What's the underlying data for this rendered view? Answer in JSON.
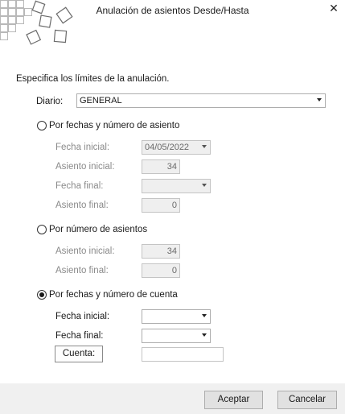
{
  "window": {
    "title": "Anulación de asientos Desde/Hasta",
    "close_icon": "close-icon"
  },
  "intro": "Especifica los límites de la anulación.",
  "diario": {
    "label": "Diario:",
    "value": "GENERAL"
  },
  "option1": {
    "label": "Por fechas y número de asiento",
    "selected": false,
    "fecha_inicial_label": "Fecha inicial:",
    "fecha_inicial_value": "04/05/2022",
    "asiento_inicial_label": "Asiento inicial:",
    "asiento_inicial_value": "34",
    "fecha_final_label": "Fecha final:",
    "fecha_final_value": "",
    "asiento_final_label": "Asiento final:",
    "asiento_final_value": "0"
  },
  "option2": {
    "label": "Por número de asientos",
    "selected": false,
    "asiento_inicial_label": "Asiento inicial:",
    "asiento_inicial_value": "34",
    "asiento_final_label": "Asiento final:",
    "asiento_final_value": "0"
  },
  "option3": {
    "label": "Por fechas y número de cuenta",
    "selected": true,
    "fecha_inicial_label": "Fecha inicial:",
    "fecha_inicial_value": "",
    "fecha_final_label": "Fecha final:",
    "fecha_final_value": "",
    "cuenta_button": "Cuenta:",
    "cuenta_value": ""
  },
  "buttons": {
    "accept": "Aceptar",
    "cancel": "Cancelar"
  }
}
